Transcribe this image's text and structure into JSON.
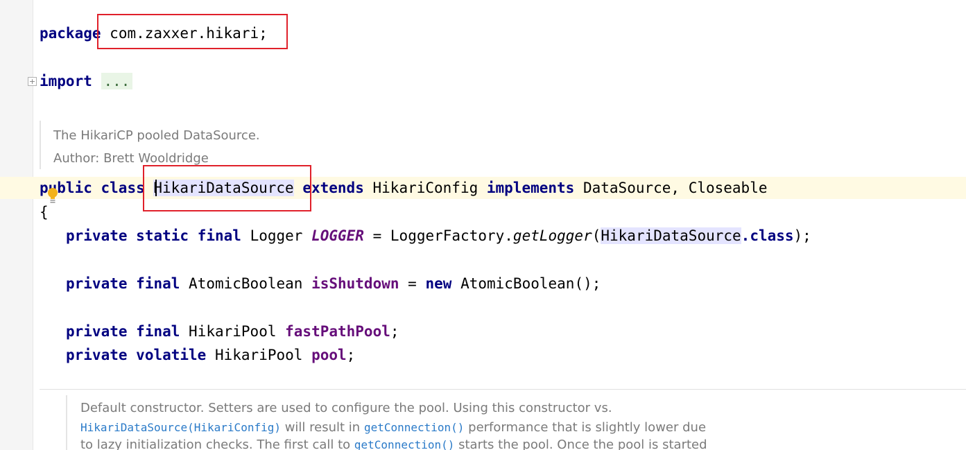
{
  "editor": {
    "package_line": {
      "kw": "package",
      "name": "com.zaxxer.hikari;"
    },
    "import_line": {
      "kw": "import",
      "folded": "..."
    },
    "class_doc": {
      "line1": "The HikariCP pooled DataSource.",
      "line2": "Author: Brett Wooldridge"
    },
    "class_decl": {
      "kw_public": "public",
      "kw_class": "class",
      "class_name": "HikariDataSource",
      "kw_extends": "extends",
      "super_name": "HikariConfig",
      "kw_implements": "implements",
      "interfaces": "DataSource, Closeable"
    },
    "open_brace": "{",
    "field_logger": {
      "kw_private": "private",
      "kw_static": "static",
      "kw_final": "final",
      "type": "Logger",
      "name": "LOGGER",
      "eq": "=",
      "factory": "LoggerFactory.",
      "method": "getLogger",
      "paren_open": "(",
      "arg_class": "HikariDataSource",
      "dot_class_kw": ".class",
      "tail": ");"
    },
    "field_shutdown": {
      "kw_private": "private",
      "kw_final": "final",
      "type": "AtomicBoolean",
      "name": "isShutdown",
      "eq": "=",
      "kw_new": "new",
      "ctor": "AtomicBoolean();"
    },
    "field_fastpath": {
      "kw_private": "private",
      "kw_final": "final",
      "type": "HikariPool",
      "name": "fastPathPool",
      "tail": ";"
    },
    "field_pool": {
      "kw_private": "private",
      "kw_volatile": "volatile",
      "type": "HikariPool",
      "name": "pool",
      "tail": ";"
    },
    "ctor_doc": {
      "line1": "Default constructor. Setters are used to configure the pool. Using this constructor vs.",
      "line2_link": "HikariDataSource(HikariConfig)",
      "line2_mid": " will result in ",
      "line2_link2": "getConnection()",
      "line2_end": " performance that is slightly lower due",
      "line3_start": "to lazy initialization checks. The first call to ",
      "line3_link": "getConnection()",
      "line3_end": " starts the pool. Once the pool is started"
    }
  },
  "colors": {
    "keyword": "#000080",
    "field": "#660e7a",
    "highlight": "#e4e4ff",
    "current_line": "#fffae3",
    "annotation_box": "#e0202a",
    "doc_text": "#7a7a7a",
    "doc_link": "#2a7ac8"
  },
  "icons": {
    "fold": "fold-expand-icon",
    "intention": "lightbulb-icon"
  }
}
